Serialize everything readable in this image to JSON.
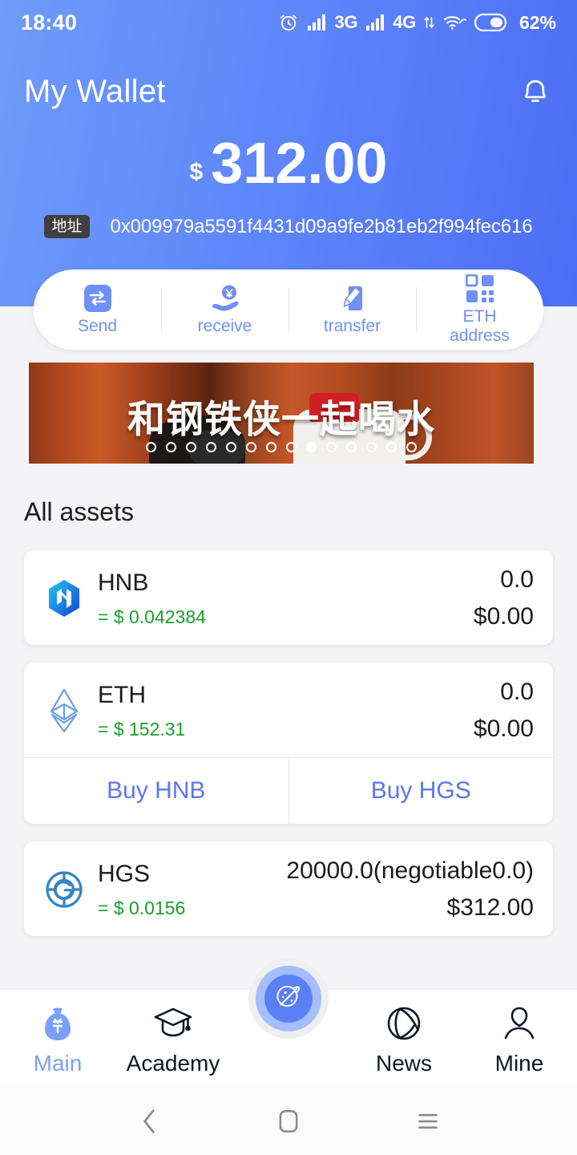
{
  "status_bar": {
    "time": "18:40",
    "network_3g": "3G",
    "network_4g": "4G",
    "battery": "62%"
  },
  "header": {
    "title": "My Wallet",
    "currency_symbol": "$",
    "balance": "312.00",
    "address_badge": "地址",
    "address": "0x009979a5591f4431d09a9fe2b81eb2f994fec616"
  },
  "actions": [
    {
      "label": "Send",
      "icon": "swap-icon"
    },
    {
      "label": "receive",
      "icon": "hand-coin-icon"
    },
    {
      "label": "transfer",
      "icon": "card-pen-icon"
    },
    {
      "label": "ETH\naddress",
      "label_line1": "ETH",
      "label_line2": "address",
      "icon": "qr-code-icon"
    }
  ],
  "banner": {
    "text": "和钢铁侠一起喝水",
    "dot_count": 14,
    "active_dot": 9
  },
  "assets_section": {
    "title": "All assets"
  },
  "assets": [
    {
      "symbol": "HNB",
      "icon": "hnb-token-icon",
      "price": "= $ 0.042384",
      "quantity": "0.0",
      "value": "$0.00"
    },
    {
      "symbol": "ETH",
      "icon": "eth-token-icon",
      "price": "= $ 152.31",
      "quantity": "0.0",
      "value": "$0.00",
      "buy_buttons": [
        "Buy HNB",
        "Buy HGS"
      ]
    },
    {
      "symbol": "HGS",
      "icon": "hgs-token-icon",
      "price": "= $ 0.0156",
      "quantity": "20000.0(negotiable0.0)",
      "value": "$312.00"
    }
  ],
  "tabbar": [
    {
      "label": "Main",
      "icon": "money-bag-icon",
      "active": true
    },
    {
      "label": "Academy",
      "icon": "graduation-cap-icon",
      "active": false
    },
    {
      "label": "News",
      "icon": "globe-icon",
      "active": false
    },
    {
      "label": "Mine",
      "icon": "person-icon",
      "active": false
    }
  ],
  "fab": {
    "icon": "planet-icon"
  },
  "android_nav": {
    "back": "back-icon",
    "home": "home-icon",
    "recents": "menu-icon"
  },
  "colors": {
    "gradient_start": "#6f9bfa",
    "gradient_end": "#4c6ef5",
    "accent_blue": "#5b77f3",
    "price_green": "#18a02a",
    "action_blue": "#6f90f5",
    "banner_orange": "#b4491f"
  }
}
